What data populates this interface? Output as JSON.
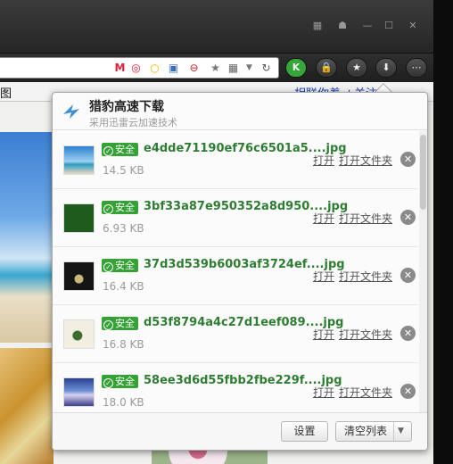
{
  "browser": {
    "window_buttons": [
      "▦",
      "☗",
      "—",
      "☐",
      "✕"
    ],
    "toolbar_buttons": [
      {
        "name": "k-button",
        "glyph": "K"
      },
      {
        "name": "lock-button",
        "glyph": "🔒"
      },
      {
        "name": "favorite-button",
        "glyph": "★"
      },
      {
        "name": "download-button",
        "glyph": "⬇"
      },
      {
        "name": "more-button",
        "glyph": "⋯"
      }
    ],
    "bookmark_left": "图",
    "bookmark_right": "相联你着 +关注"
  },
  "panel": {
    "title": "猎豹高速下载",
    "subtitle": "采用迅雷云加速技术",
    "safe_label": "安全",
    "open_label": "打开",
    "open_folder_label": "打开文件夹",
    "items": [
      {
        "filename": "e4dde71190ef76c6501a5....jpg",
        "size": "14.5 KB"
      },
      {
        "filename": "3bf33a87e950352a8d950....jpg",
        "size": "6.93 KB"
      },
      {
        "filename": "37d3d539b6003af3724ef....jpg",
        "size": "16.4 KB"
      },
      {
        "filename": "d53f8794a4c27d1eef089....jpg",
        "size": "16.8 KB"
      },
      {
        "filename": "58ee3d6d55fbb2fbe229f....jpg",
        "size": "18.0 KB"
      }
    ],
    "settings_label": "设置",
    "clear_label": "清空列表"
  }
}
